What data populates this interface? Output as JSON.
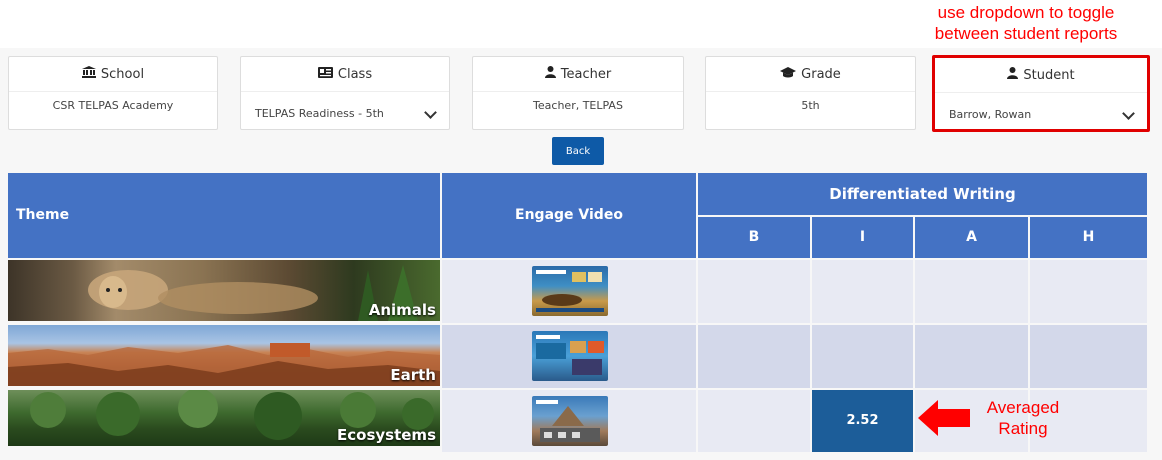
{
  "annotations": {
    "dropdown_note_line1": "use dropdown to toggle",
    "dropdown_note_line2": "between student reports",
    "rating_note_line1": "Averaged",
    "rating_note_line2": "Rating"
  },
  "filters": {
    "school": {
      "label": "School",
      "icon": "institution-icon",
      "value": "CSR TELPAS Academy"
    },
    "class": {
      "label": "Class",
      "icon": "id-card-icon",
      "value": "TELPAS Readiness - 5th"
    },
    "teacher": {
      "label": "Teacher",
      "icon": "user-icon",
      "value": "Teacher, TELPAS"
    },
    "grade": {
      "label": "Grade",
      "icon": "graduation-cap-icon",
      "value": "5th"
    },
    "student": {
      "label": "Student",
      "icon": "user-icon",
      "value": "Barrow, Rowan"
    }
  },
  "back_label": "Back",
  "table": {
    "headers": {
      "theme": "Theme",
      "engage": "Engage Video",
      "group": "Differentiated Writing",
      "levels": [
        "B",
        "I",
        "A",
        "H"
      ]
    },
    "rows": [
      {
        "theme": "Animals",
        "ratings": [
          "",
          "",
          "",
          ""
        ]
      },
      {
        "theme": "Earth",
        "ratings": [
          "",
          "",
          "",
          ""
        ]
      },
      {
        "theme": "Ecosystems",
        "ratings": [
          "",
          "2.52",
          "",
          ""
        ]
      }
    ]
  },
  "colors": {
    "header_blue": "#4472c4",
    "rating_blue": "#1c5d99",
    "button_blue": "#0e5aa7",
    "annotation_red": "#ff0000"
  }
}
